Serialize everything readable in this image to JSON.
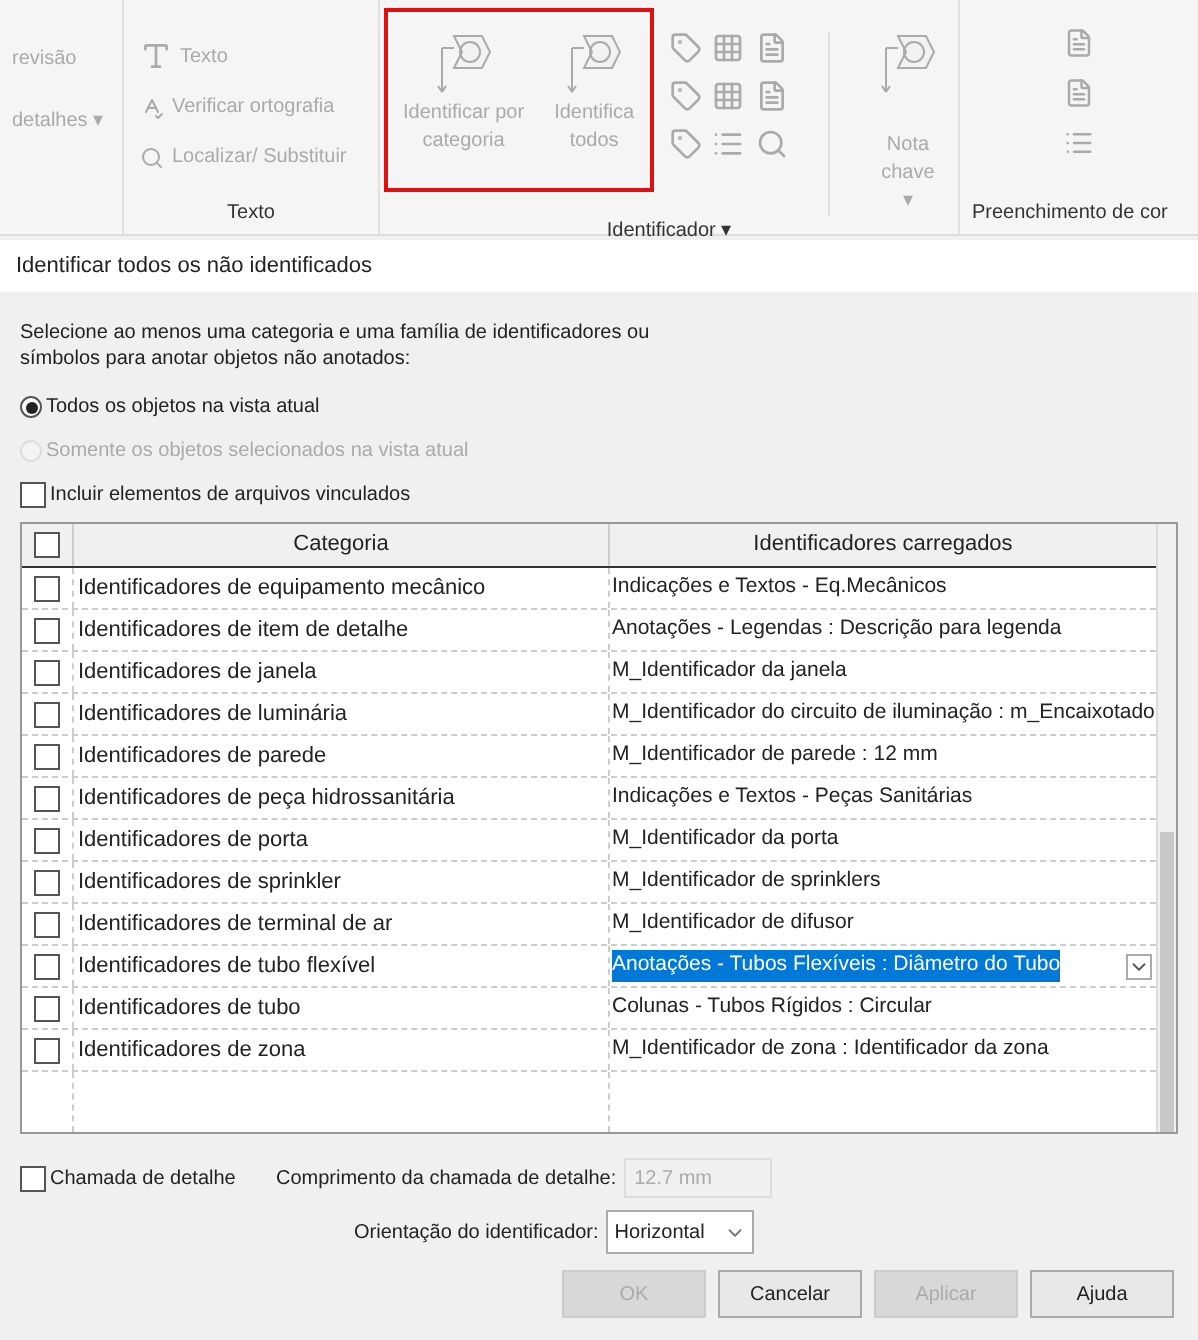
{
  "ribbon": {
    "partial_items": [
      "revisão",
      "detalhes ▾"
    ],
    "text_panel": {
      "label": "Texto",
      "items": [
        "Texto",
        "Verificar  ortografia",
        "Localizar/  Substituir"
      ]
    },
    "tag_panel": {
      "label": "Identificador ▾",
      "highlighted": true,
      "large_buttons": [
        {
          "lines": [
            "Identificar por",
            "categoria"
          ]
        },
        {
          "lines": [
            "Identifica",
            "todos"
          ]
        }
      ]
    },
    "keynote": {
      "label": "Nota chave",
      "caret": "▾"
    },
    "fill_panel": {
      "label": "Preenchimento de cor"
    }
  },
  "dialog": {
    "title": "Identificar todos os não identificados",
    "instruction": "Selecione ao menos uma categoria e uma família de identificadores ou símbolos para anotar objetos não anotados:",
    "scope": [
      {
        "label": "Todos os objetos na vista atual",
        "selected": true,
        "disabled": false
      },
      {
        "label": "Somente os objetos selecionados na vista atual",
        "selected": false,
        "disabled": true
      }
    ],
    "include_linked": {
      "label": "Incluir elementos de arquivos vinculados",
      "checked": false
    },
    "table": {
      "all_checked": false,
      "columns": [
        "Categoria",
        "Identificadores carregados"
      ],
      "rows": [
        {
          "category": "Identificadores de equipamento mecânico",
          "tag": "Indicações e Textos - Eq.Mecânicos",
          "checked": false,
          "selected": false
        },
        {
          "category": "Identificadores de item de detalhe",
          "tag": "Anotações - Legendas : Descrição para legenda",
          "checked": false,
          "selected": false
        },
        {
          "category": "Identificadores de janela",
          "tag": "M_Identificador da janela",
          "checked": false,
          "selected": false
        },
        {
          "category": "Identificadores de luminária",
          "tag": "M_Identificador do circuito de iluminação : m_Encaixotado",
          "checked": false,
          "selected": false
        },
        {
          "category": "Identificadores de parede",
          "tag": "M_Identificador de parede : 12 mm",
          "checked": false,
          "selected": false
        },
        {
          "category": "Identificadores de peça hidrossanitária",
          "tag": "Indicações e Textos - Peças Sanitárias",
          "checked": false,
          "selected": false
        },
        {
          "category": "Identificadores de porta",
          "tag": "M_Identificador da porta",
          "checked": false,
          "selected": false
        },
        {
          "category": "Identificadores de sprinkler",
          "tag": "M_Identificador de sprinklers",
          "checked": false,
          "selected": false
        },
        {
          "category": "Identificadores de terminal de ar",
          "tag": "M_Identificador de difusor",
          "checked": false,
          "selected": false
        },
        {
          "category": "Identificadores de tubo flexível",
          "tag": "Anotações - Tubos Flexíveis : Diâmetro do Tubo",
          "checked": false,
          "selected": true
        },
        {
          "category": "Identificadores de tubo",
          "tag": "Colunas - Tubos Rígidos : Circular",
          "checked": false,
          "selected": false
        },
        {
          "category": "Identificadores de zona",
          "tag": "M_Identificador de zona : Identificador da zona",
          "checked": false,
          "selected": false
        }
      ]
    },
    "leader": {
      "label": "Chamada de detalhe",
      "checked": false
    },
    "leader_length": {
      "label": "Comprimento da chamada de detalhe:",
      "value": "12.7 mm",
      "disabled": true
    },
    "orientation": {
      "label": "Orientação do identificador:",
      "value": "Horizontal"
    },
    "buttons": [
      {
        "label": "OK",
        "disabled": true
      },
      {
        "label": "Cancelar",
        "disabled": false
      },
      {
        "label": "Aplicar",
        "disabled": true
      },
      {
        "label": "Ajuda",
        "disabled": false
      }
    ]
  }
}
